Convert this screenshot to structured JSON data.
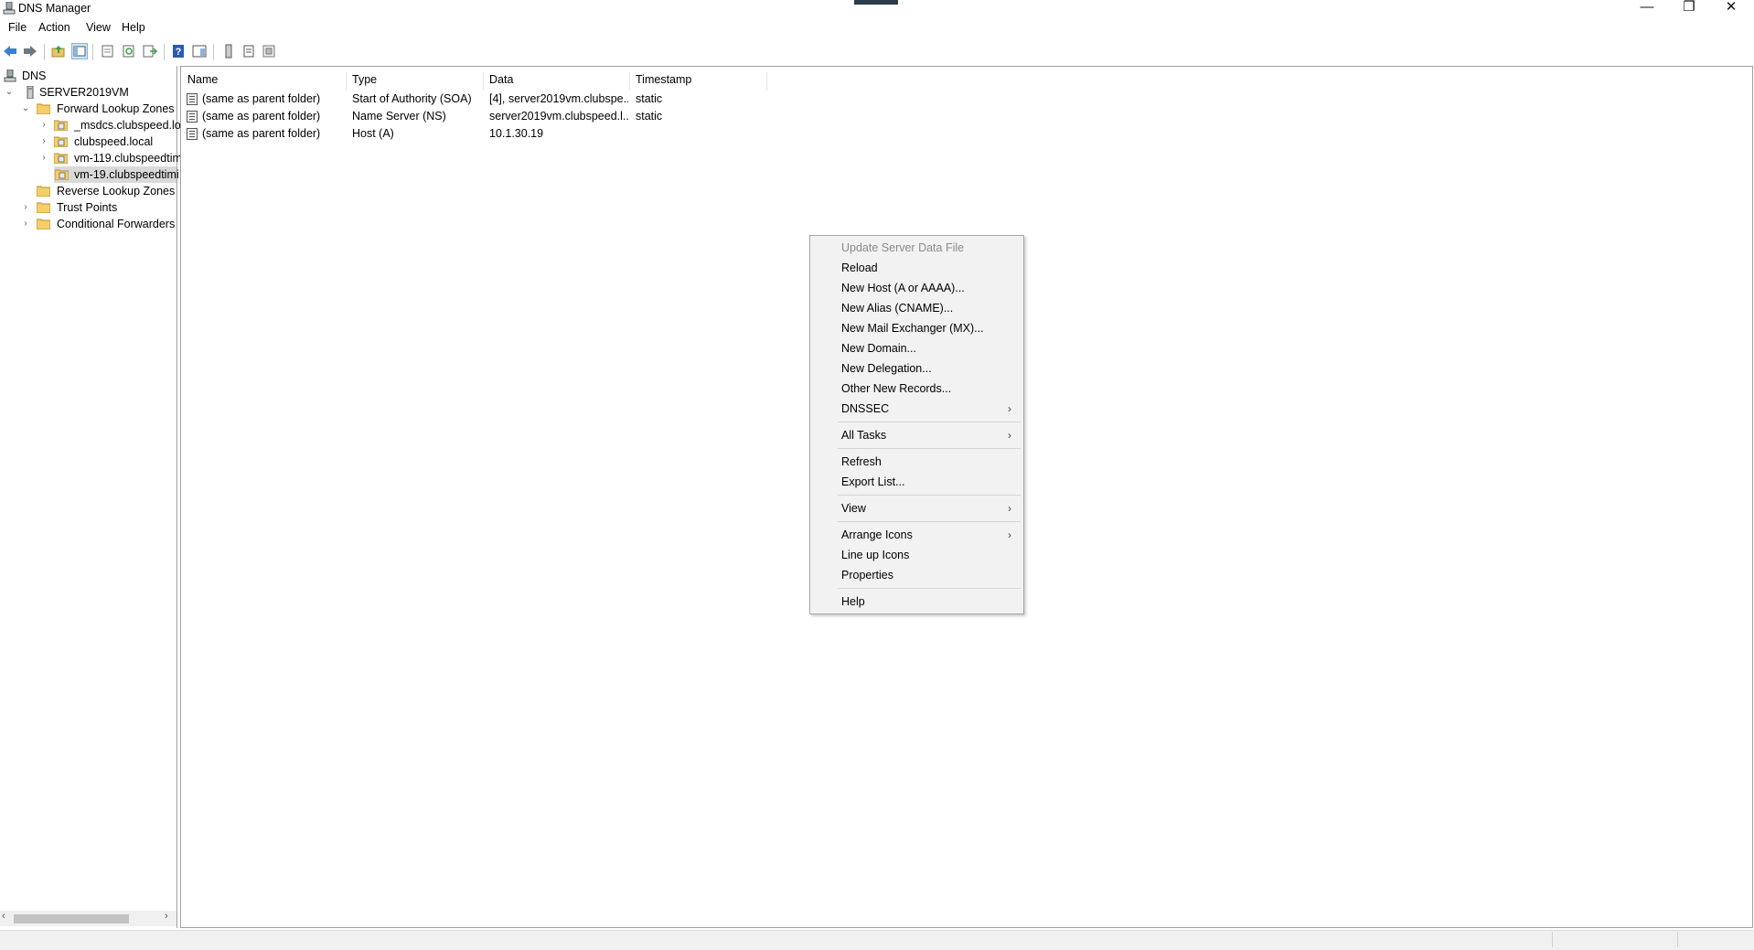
{
  "window": {
    "title": "DNS Manager",
    "controls": {
      "minimize": "—",
      "maximize": "❐",
      "close": "✕"
    }
  },
  "menubar": [
    "File",
    "Action",
    "View",
    "Help"
  ],
  "toolbar": {
    "buttons": [
      "back-icon",
      "forward-icon",
      "up-folder-icon",
      "show-hide-console-tree-icon",
      "properties-icon",
      "refresh-icon",
      "export-list-icon",
      "help-icon",
      "show-hide-action-pane-icon",
      "server-icon",
      "list-view-icon",
      "zone-icon"
    ]
  },
  "tree": {
    "items": [
      {
        "label": "DNS",
        "icon": "dns-icon",
        "expander": ""
      },
      {
        "label": "SERVER2019VM",
        "icon": "server-icon",
        "expander": "⌄"
      },
      {
        "label": "Forward Lookup Zones",
        "icon": "folder-icon",
        "expander": "⌄"
      },
      {
        "label": "_msdcs.clubspeed.lo",
        "icon": "zone-icon",
        "expander": "›"
      },
      {
        "label": "clubspeed.local",
        "icon": "zone-icon",
        "expander": "›"
      },
      {
        "label": "vm-119.clubspeedtim",
        "icon": "zone-icon",
        "expander": "›"
      },
      {
        "label": "vm-19.clubspeedtimi",
        "icon": "zone-icon",
        "expander": ""
      },
      {
        "label": "Reverse Lookup Zones",
        "icon": "folder-icon",
        "expander": ""
      },
      {
        "label": "Trust Points",
        "icon": "folder-icon",
        "expander": "›"
      },
      {
        "label": "Conditional Forwarders",
        "icon": "folder-icon",
        "expander": "›"
      }
    ],
    "scroll_left": "‹",
    "scroll_right": "›"
  },
  "list": {
    "columns": [
      "Name",
      "Type",
      "Data",
      "Timestamp"
    ],
    "rows": [
      {
        "name": "(same as parent folder)",
        "type": "Start of Authority (SOA)",
        "data": "[4], server2019vm.clubspe...",
        "timestamp": "static"
      },
      {
        "name": "(same as parent folder)",
        "type": "Name Server (NS)",
        "data": "server2019vm.clubspeed.l...",
        "timestamp": "static"
      },
      {
        "name": "(same as parent folder)",
        "type": "Host (A)",
        "data": "10.1.30.19",
        "timestamp": ""
      }
    ]
  },
  "context_menu": {
    "items": [
      {
        "label": "Update Server Data File",
        "disabled": true
      },
      {
        "label": "Reload"
      },
      {
        "label": "New Host (A or AAAA)..."
      },
      {
        "label": "New Alias (CNAME)..."
      },
      {
        "label": "New Mail Exchanger (MX)..."
      },
      {
        "label": "New Domain..."
      },
      {
        "label": "New Delegation..."
      },
      {
        "label": "Other New Records..."
      },
      {
        "label": "DNSSEC",
        "submenu": true
      },
      {
        "label": "All Tasks",
        "submenu": true
      },
      {
        "label": "Refresh"
      },
      {
        "label": "Export List..."
      },
      {
        "label": "View",
        "submenu": true
      },
      {
        "label": "Arrange Icons",
        "submenu": true
      },
      {
        "label": "Line up Icons"
      },
      {
        "label": "Properties"
      },
      {
        "label": "Help"
      }
    ],
    "submenu_arrow": "›"
  }
}
